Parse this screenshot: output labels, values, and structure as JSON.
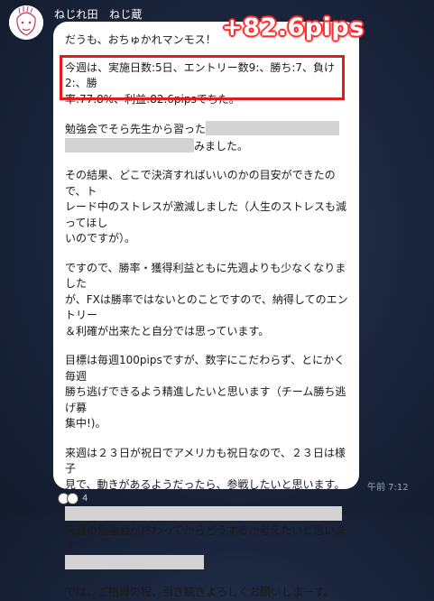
{
  "header": {
    "sender_name": "ねじれ田　ねじ蔵"
  },
  "overlay": {
    "pips_label": "+82.6pips",
    "accent_color": "#ff2d2d"
  },
  "message": {
    "greeting": "だうも、おちゅかれマンモス！",
    "highlight_line1": "今週は、実施日数:5日、エントリー数9:、勝ち:7、負け2:、勝",
    "highlight_line2": "率:77.8%、利益:82.6pipsでちた。",
    "study_line1": "勉強会でそら先生から習った",
    "study_line2": "みました。",
    "result_line1": "その結果、どこで決済すればいいのかの目安ができたので、ト",
    "result_line2": "レード中のストレスが激減しました（人生のストレスも減ってほし",
    "result_line3": "いのですが）。",
    "winrate_line1": "ですので、勝率・獲得利益ともに先週よりも少なくなりました",
    "winrate_line2": "が、FXは勝率ではないとのことですので、納得してのエントリー",
    "winrate_line3": "＆利確が出来たと自分では思っています。",
    "goal_line1": "目標は毎週100pipsですが、数字にこだわらず、とにかく毎週",
    "goal_line2": "勝ち逃げできるよう精進したいと思います（チーム勝ち逃げ募",
    "goal_line3": "集中!)。",
    "next_line1": "来週は２３日が祝日でアメリカも祝日なので、２３日は様子",
    "next_line2": "見で、動きがあるようだったら、参戦したいと思います。",
    "after_line": "来週の勉強会が終わってからどうするか考えたいと思います",
    "closing": "では、ご指導の程、引き続きよろしくお願いしま－す。"
  },
  "meta": {
    "timestamp": "午前 7:12",
    "reaction_count": "4"
  }
}
